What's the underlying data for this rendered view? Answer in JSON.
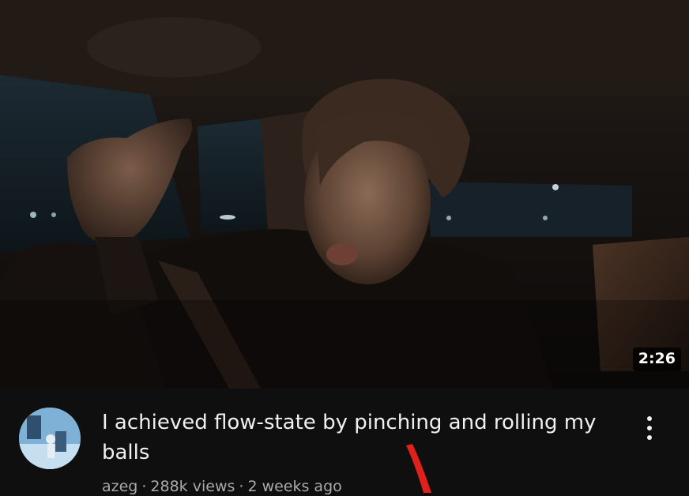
{
  "video": {
    "duration": "2:26",
    "title": "I achieved flow-state by pinching and rolling my balls",
    "channel": "azeg",
    "views": "288k views",
    "age": "2 weeks ago",
    "separator": "·"
  },
  "icons": {
    "more": "more-vert-icon",
    "annotation": "red-arrow-mark"
  },
  "colors": {
    "background": "#0f0f0f",
    "title_text": "#f1f1f1",
    "meta_text": "#aaaaaa",
    "annotation": "#e0201a"
  }
}
